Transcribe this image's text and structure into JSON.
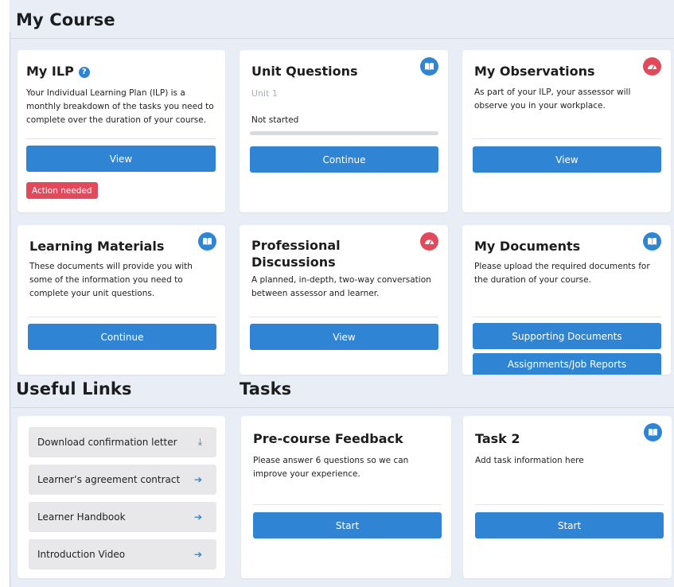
{
  "sections": {
    "my_course": "My Course",
    "useful_links": "Useful Links",
    "tasks": "Tasks"
  },
  "colors": {
    "accent": "#2f84d3",
    "alert": "#e2495b",
    "background": "#e9eef6"
  },
  "my_ilp": {
    "title": "My ILP",
    "help_glyph": "?",
    "text": "Your Individual Learning Plan (ILP) is a monthly breakdown of the tasks you need to complete over the duration of your course.",
    "button": "View",
    "badge": "Action needed"
  },
  "unit_questions": {
    "title": "Unit Questions",
    "icon": "book-icon",
    "unit": "Unit 1",
    "status": "Not started",
    "progress": 0,
    "button": "Continue"
  },
  "my_observations": {
    "title": "My Observations",
    "icon": "gauge-icon",
    "text": "As part of your ILP, your assessor will observe you in your workplace.",
    "button": "View"
  },
  "learning_materials": {
    "title": "Learning Materials",
    "icon": "book-icon",
    "text": "These documents will provide you with some of the information you need to complete your unit questions.",
    "button": "Continue"
  },
  "professional_discussions": {
    "title_line1": "Professional",
    "title_line2": "Discussions",
    "icon": "gauge-icon",
    "text": "A planned, in-depth, two-way conversation between assessor and learner.",
    "button": "View"
  },
  "my_documents": {
    "title": "My Documents",
    "icon": "book-icon",
    "text": "Please upload the required documents for the duration of your course.",
    "button_1": "Supporting Documents",
    "button_2": "Assignments/Job Reports"
  },
  "useful_links": {
    "items": [
      {
        "label": "Download confirmation letter",
        "icon": "download-icon",
        "glyph": "⤓"
      },
      {
        "label": "Learner’s agreement contract",
        "icon": "arrow-right-icon",
        "glyph": "➔"
      },
      {
        "label": "Learner Handbook",
        "icon": "arrow-right-icon",
        "glyph": "➔"
      },
      {
        "label": "Introduction Video",
        "icon": "arrow-right-icon",
        "glyph": "➔"
      }
    ]
  },
  "precourse_feedback": {
    "title": "Pre-course Feedback",
    "text": "Please answer 6 questions so we can improve your experience.",
    "button": "Start"
  },
  "task_2": {
    "title": "Task 2",
    "icon": "book-icon",
    "text": "Add task information here",
    "button": "Start"
  }
}
